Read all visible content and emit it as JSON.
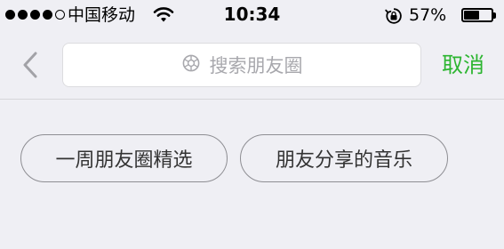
{
  "status_bar": {
    "carrier": "中国移动",
    "time": "10:34",
    "battery_percent": "57%",
    "battery_level": 0.57,
    "signal_dots_filled": 4,
    "signal_dots_total": 5,
    "icons": [
      "wifi-icon",
      "rotation-lock-icon",
      "battery-icon"
    ]
  },
  "search": {
    "placeholder": "搜索朋友圈",
    "icon": "moments-shutter-icon",
    "cancel_label": "取消",
    "back_icon": "chevron-left-icon"
  },
  "chips": [
    {
      "label": "一周朋友圈精选"
    },
    {
      "label": "朋友分享的音乐"
    }
  ],
  "colors": {
    "background": "#efeff4",
    "accent": "#2cb530",
    "placeholder": "#a8a8ad"
  }
}
